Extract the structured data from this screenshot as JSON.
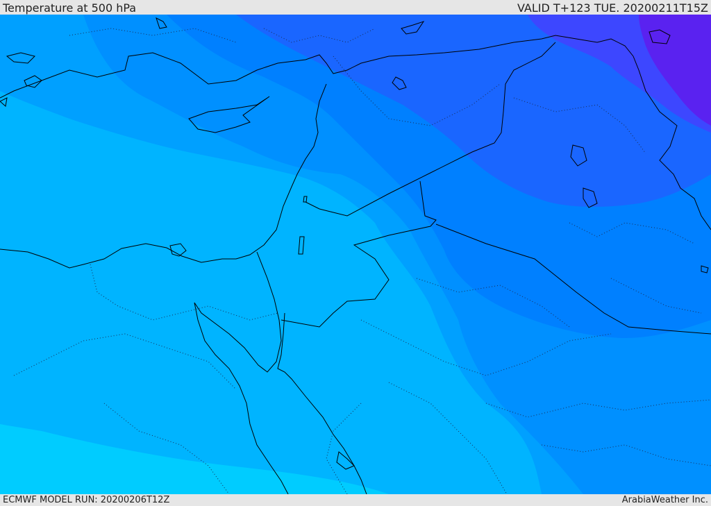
{
  "header": {
    "title": "Temperature at 500 hPa",
    "valid": "VALID T+123 TUE. 20200211T15Z"
  },
  "footer": {
    "model_run": "ECMWF MODEL RUN: 20200206T12Z",
    "brand": "ArabiaWeather Inc."
  },
  "map": {
    "field": "temperature-500hPa",
    "colors": {
      "band_1": "#00ccff",
      "band_2": "#00b4ff",
      "band_3": "#00a0ff",
      "band_4": "#0090ff",
      "band_5": "#0080ff",
      "band_6": "#1a66ff",
      "band_7": "#3d47ff",
      "band_8": "#5a22f0",
      "coastline": "#000000"
    }
  }
}
